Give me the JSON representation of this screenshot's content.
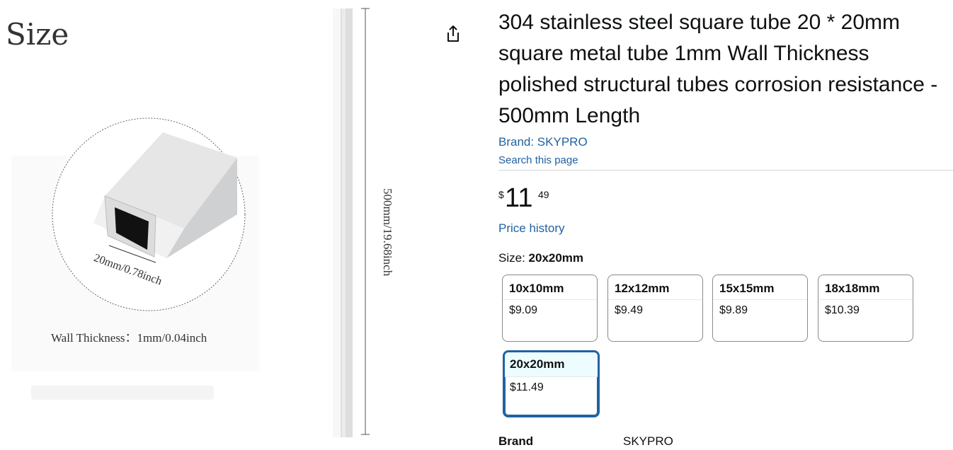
{
  "image": {
    "size_heading": "Size",
    "dimension_label": "20mm/0.78inch",
    "wall_thickness_label": "Wall Thickness：1mm/0.04inch",
    "length_label": "500mm/19.68inch"
  },
  "product": {
    "title": "304 stainless steel square tube 20 * 20mm square metal tube 1mm Wall Thickness polished structural tubes corrosion resistance - 500mm Length",
    "brand_link": "Brand: SKYPRO",
    "search_link": "Search this page",
    "price": {
      "symbol": "$",
      "whole": "11",
      "fraction": "49"
    },
    "price_history": "Price history",
    "size_label": "Size: ",
    "size_value": "20x20mm"
  },
  "sizes": [
    {
      "name": "10x10mm",
      "price": "$9.09"
    },
    {
      "name": "12x12mm",
      "price": "$9.49"
    },
    {
      "name": "15x15mm",
      "price": "$9.89"
    },
    {
      "name": "18x18mm",
      "price": "$10.39"
    },
    {
      "name": "20x20mm",
      "price": "$11.49"
    }
  ],
  "details": {
    "brand_key": "Brand",
    "brand_value": "SKYPRO"
  },
  "colors": {
    "link": "#2162a1",
    "selected_border": "#2162a1"
  },
  "icons": {
    "share": "share-icon"
  }
}
